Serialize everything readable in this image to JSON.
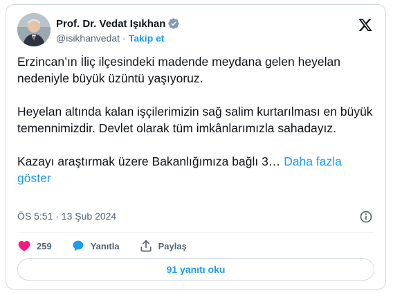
{
  "author": {
    "display_name": "Prof. Dr. Vedat Işıkhan",
    "handle": "@isikhanvedat",
    "separator": "·",
    "follow_label": "Takip et",
    "verified": true
  },
  "tweet": {
    "paragraph1": "Erzincan’ın İliç ilçesindeki madende meydana gelen heyelan nedeniyle büyük üzüntü yaşıyoruz.",
    "paragraph2": "Heyelan altında kalan işçilerimizin sağ salim kurtarılması en büyük temennimizdir. Devlet olarak tüm imkânlarımızla sahadayız.",
    "paragraph3": "Kazayı araştırmak üzere Bakanlığımıza bağlı 3…",
    "show_more": "Daha fazla göster",
    "timestamp": "ÖS 5:51 · 13 Şub 2024"
  },
  "actions": {
    "likes": "259",
    "reply_label": "Yanıtla",
    "share_label": "Paylaş"
  },
  "replies_button": "91 yanıtı oku",
  "colors": {
    "accent": "#1d9bf0",
    "like": "#f91880",
    "muted": "#536471",
    "text": "#0f1419",
    "border": "#cfd9de"
  }
}
